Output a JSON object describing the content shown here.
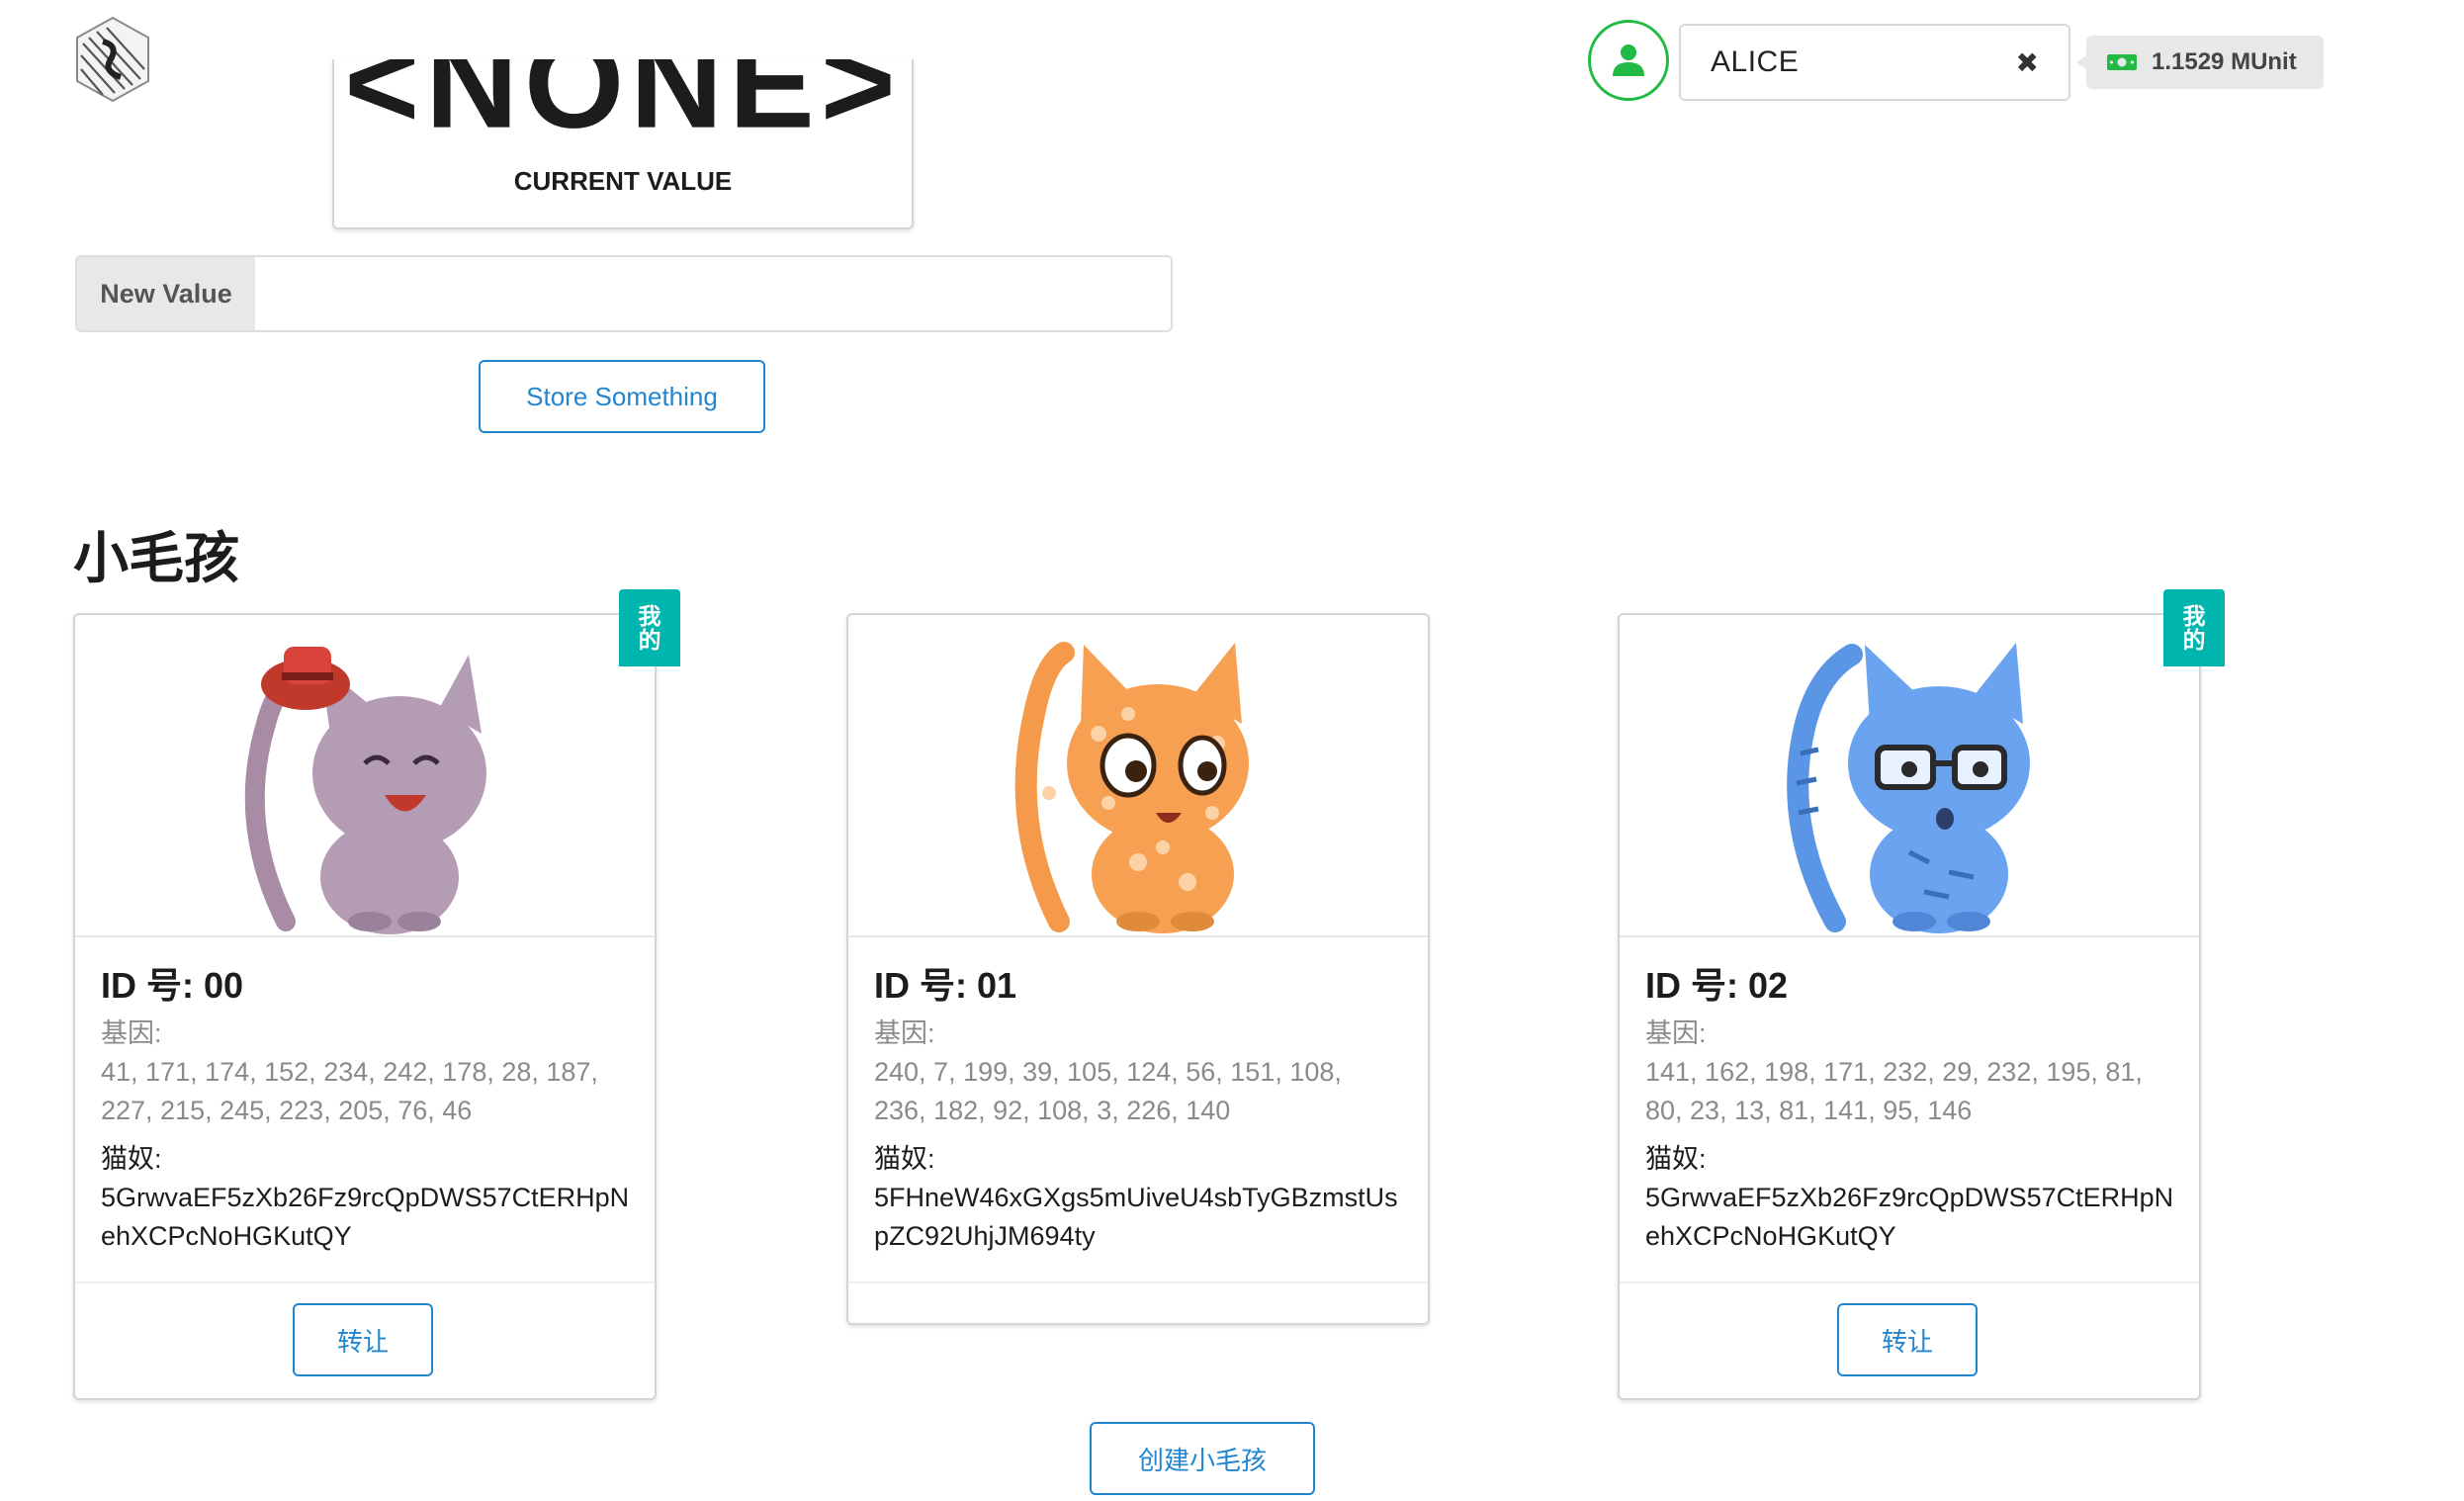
{
  "header": {
    "account_name": "ALICE",
    "clear_symbol": "✖",
    "balance": "1.1529 MUnit",
    "accent_color": "#21ba45"
  },
  "storage": {
    "current_value": "<NONE>",
    "current_value_label": "CURRENT VALUE",
    "new_value_label": "New Value",
    "new_value_input": "",
    "store_button": "Store Something"
  },
  "kitties": {
    "section_title": "小毛孩",
    "genes_label": "基因:",
    "owner_label": "猫奴:",
    "mine_badge": [
      "我",
      "的"
    ],
    "transfer_label": "转让",
    "items": [
      {
        "id": "ID 号: 00",
        "genes_line1": "41, 171, 174, 152, 234, 242, 178, 28, 187,",
        "genes_line2": "227, 215, 245, 223, 205, 76, 46",
        "owner": "5GrwvaEF5zXb26Fz9rcQpDWS57CtERHpNehXCPcNoHGKutQY",
        "mine": true,
        "icon": "purple-cat-with-red-hat"
      },
      {
        "id": "ID 号: 01",
        "genes_line1": "240, 7, 199, 39, 105, 124, 56, 151, 108,",
        "genes_line2": "236, 182, 92, 108, 3, 226, 140",
        "owner": "5FHneW46xGXgs5mUiveU4sbTyGBzmstUspZC92UhjJM694ty",
        "mine": false,
        "icon": "orange-spotted-cat"
      },
      {
        "id": "ID 号: 02",
        "genes_line1": "141, 162, 198, 171, 232, 29, 232, 195, 81,",
        "genes_line2": "80, 23, 13, 81, 141, 95, 146",
        "owner": "5GrwvaEF5zXb26Fz9rcQpDWS57CtERHpNehXCPcNoHGKutQY",
        "mine": true,
        "icon": "blue-striped-cat-with-glasses"
      }
    ],
    "create_button": "创建小毛孩"
  }
}
